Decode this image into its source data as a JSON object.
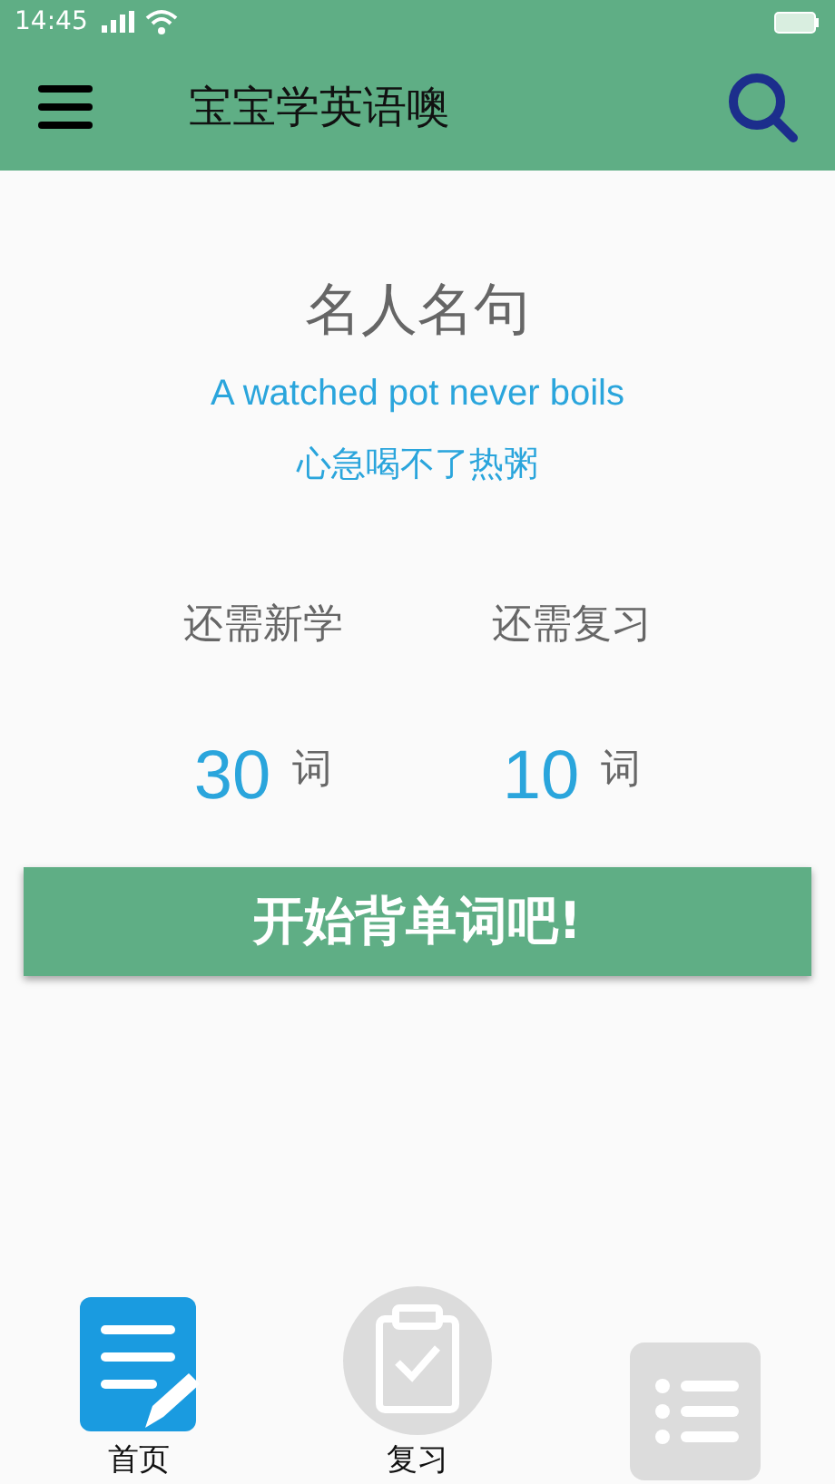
{
  "status_bar": {
    "time": "14:45"
  },
  "app_bar": {
    "title": "宝宝学英语噢"
  },
  "quote": {
    "heading": "名人名句",
    "english": "A watched pot never boils",
    "chinese": "心急喝不了热粥"
  },
  "stats": [
    {
      "label": "还需新学",
      "count": "30",
      "unit": "词"
    },
    {
      "label": "还需复习",
      "count": "10",
      "unit": "词"
    }
  ],
  "start_button": "开始背单词吧!",
  "bottom_nav": [
    {
      "kind": "notes",
      "label": "首页",
      "selected": true
    },
    {
      "kind": "review",
      "label": "复习",
      "selected": false
    },
    {
      "kind": "list",
      "selected": false
    }
  ]
}
